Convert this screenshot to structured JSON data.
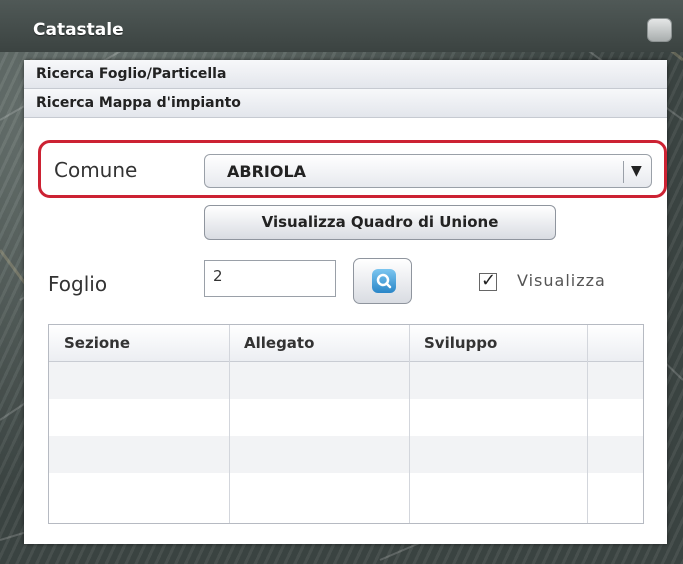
{
  "window": {
    "title": "Catastale"
  },
  "accordion": {
    "sections": [
      {
        "label": "Ricerca Foglio/Particella"
      },
      {
        "label": "Ricerca Mappa d'impianto"
      }
    ]
  },
  "form": {
    "comune_label": "Comune",
    "comune_value": "ABRIOLA",
    "quadro_button_label": "Visualizza Quadro di Unione",
    "foglio_label": "Foglio",
    "foglio_value": "2",
    "visualizza_label": "Visualizza",
    "visualizza_checked": true
  },
  "grid": {
    "columns": [
      "Sezione",
      "Allegato",
      "Sviluppo",
      ""
    ],
    "rows": []
  },
  "icons": {
    "search": "search-icon",
    "dropdown": "chevron-down-icon",
    "check": "checkmark-icon"
  },
  "colors": {
    "highlight": "#cc2233",
    "title_bar": "#3b4341"
  }
}
